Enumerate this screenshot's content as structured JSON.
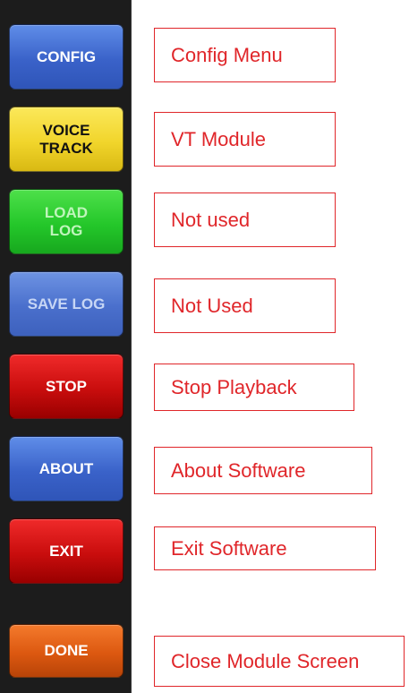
{
  "buttons": {
    "config": "CONFIG",
    "voice_track": "VOICE\nTRACK",
    "load_log": "LOAD\nLOG",
    "save_log": "SAVE LOG",
    "stop": "STOP",
    "about": "ABOUT",
    "exit": "EXIT",
    "done": "DONE"
  },
  "annotations": {
    "config": "Config Menu",
    "voice_track": "VT Module",
    "load_log": "Not used",
    "save_log": "Not Used",
    "stop": "Stop Playback",
    "about": "About Software",
    "exit": "Exit Software",
    "done": "Close Module Screen"
  },
  "colors": {
    "panel_bg": "#1c1c1c",
    "annotation": "#e0262a",
    "blue": "#3a62c9",
    "yellow": "#f1d52b",
    "green": "#24c72a",
    "red": "#c90d0d",
    "orange": "#dc5810"
  }
}
